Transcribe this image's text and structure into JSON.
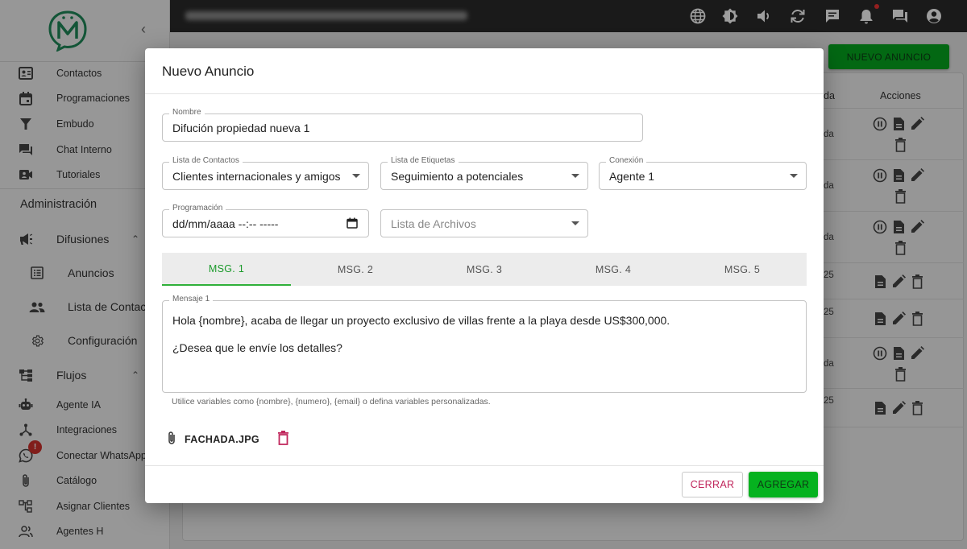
{
  "sidebar": {
    "items_top": [
      {
        "label": "Contactos",
        "icon": "contacts-icon"
      },
      {
        "label": "Programaciones",
        "icon": "calendar-icon"
      },
      {
        "label": "Embudo",
        "icon": "funnel-icon"
      },
      {
        "label": "Chat Interno",
        "icon": "chat-icon"
      },
      {
        "label": "Tutoriales",
        "icon": "video-icon"
      }
    ],
    "admin_title": "Administración",
    "difusiones": "Difusiones",
    "difusiones_sub": [
      {
        "label": "Anuncios",
        "icon": "list-icon"
      },
      {
        "label": "Lista de Contactos",
        "icon": "people-icon"
      },
      {
        "label": "Configuración",
        "icon": "gear-icon"
      }
    ],
    "flujos": "Flujos",
    "items_bottom": [
      {
        "label": "Agente IA",
        "icon": "robot-icon"
      },
      {
        "label": "Integraciones",
        "icon": "integration-icon"
      },
      {
        "label": "Conectar WhatsApp",
        "icon": "whatsapp-icon"
      },
      {
        "label": "Catálogo",
        "icon": "paperclip-icon"
      },
      {
        "label": "Asignar Clientes",
        "icon": "hierarchy-icon"
      },
      {
        "label": "Agentes H",
        "icon": "agents-icon"
      }
    ],
    "whatsapp_badge": "!"
  },
  "page": {
    "new_button": "NUEVO ANUNCIO",
    "col_partial": "da",
    "col_actions": "Acciones",
    "rows": [
      {
        "text": "da"
      },
      {
        "text": "da"
      },
      {
        "text": "da"
      },
      {
        "text": "25"
      },
      {
        "text": "25"
      },
      {
        "text": "da"
      },
      {
        "text": "25"
      }
    ]
  },
  "modal": {
    "title": "Nuevo Anuncio",
    "nombre_label": "Nombre",
    "nombre_value": "Difución propiedad nueva 1",
    "lista_contactos_label": "Lista de Contactos",
    "lista_contactos_value": "Clientes internacionales y amigos",
    "lista_etiquetas_label": "Lista de Etiquetas",
    "lista_etiquetas_value": "Seguimiento a potenciales",
    "conexion_label": "Conexión",
    "conexion_value": "Agente 1",
    "programacion_label": "Programación",
    "programacion_value": "dd/mm/aaaa --:-- -----",
    "lista_archivos_placeholder": "Lista de Archivos",
    "tabs": [
      "MSG. 1",
      "MSG. 2",
      "MSG. 3",
      "MSG. 4",
      "MSG. 5"
    ],
    "mensaje_label": "Mensaje 1",
    "mensaje_line1": "Hola {nombre}, acaba de llegar un proyecto exclusivo de villas frente a la playa desde US$300,000.",
    "mensaje_line2": "¿Desea que le envíe los detalles?",
    "helper": "Utilice variables como {nombre}, {numero}, {email} o defina variables personalizadas.",
    "attachment": "FACHADA.JPG",
    "close_button": "CERRAR",
    "add_button": "AGREGAR"
  },
  "colors": {
    "accent": "#05b21f",
    "danger": "#c0255b"
  }
}
